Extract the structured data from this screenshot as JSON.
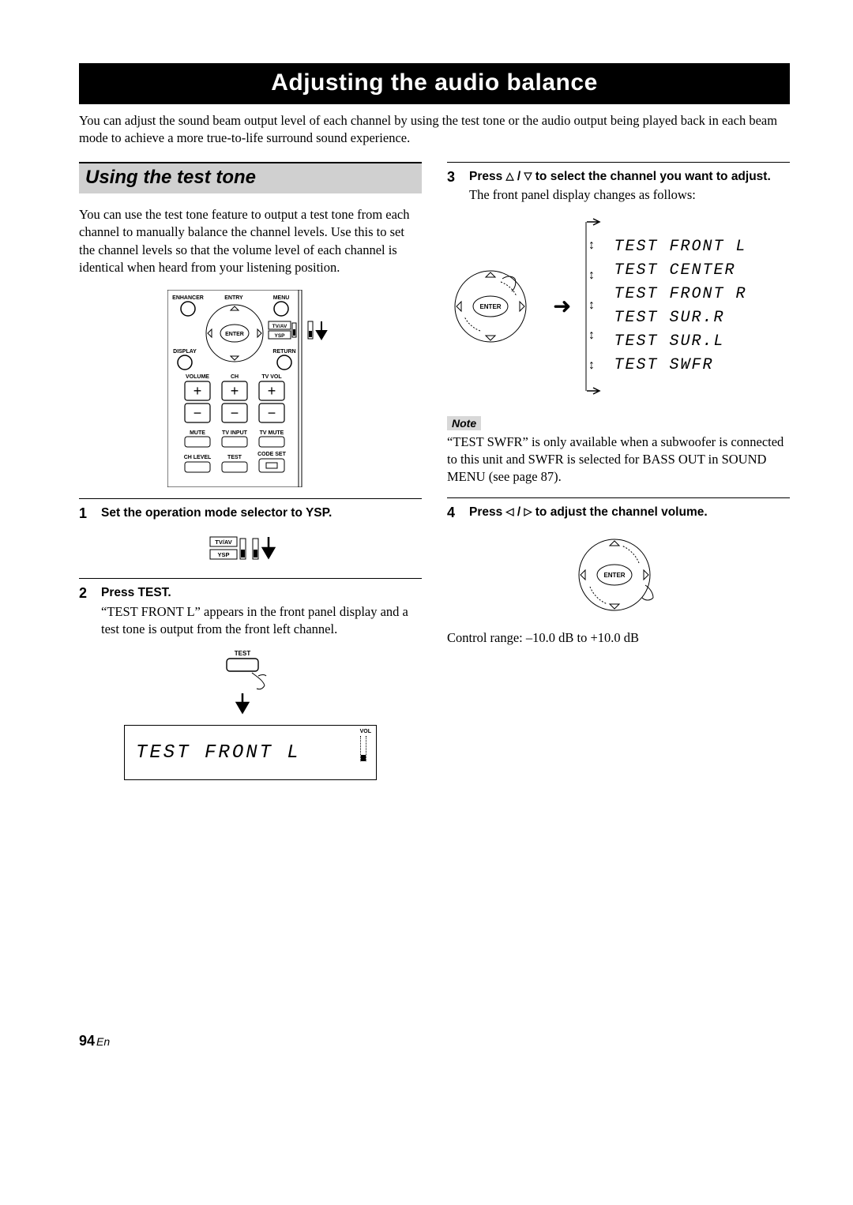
{
  "banner": "Adjusting the audio balance",
  "intro": "You can adjust the sound beam output level of each channel by using the test tone or the audio output being played back in each beam mode to achieve a more true-to-life surround sound experience.",
  "left": {
    "section_head": "Using the test tone",
    "section_body": "You can use the test tone feature to output a test tone from each channel to manually balance the channel levels. Use this to set the channel levels so that the volume level of each channel is identical when heard from your listening position.",
    "remote": {
      "row1": [
        "ENHANCER",
        "ENTRY",
        "MENU"
      ],
      "dpad_enter": "ENTER",
      "mode_labels": [
        "TV/AV",
        "YSP"
      ],
      "row2_left": "DISPLAY",
      "row2_right": "RETURN",
      "col_labels": [
        "VOLUME",
        "CH",
        "TV VOL"
      ],
      "plus": "+",
      "minus": "−",
      "row3": [
        "MUTE",
        "TV INPUT",
        "TV MUTE"
      ],
      "row4_left": "CH LEVEL",
      "row4_mid": "TEST",
      "row4_right": "CODE SET"
    },
    "step1_title": "Set the operation mode selector to YSP.",
    "step1_labels": [
      "TV/AV",
      "YSP"
    ],
    "step2_title": "Press TEST.",
    "step2_text": "“TEST FRONT L” appears in the front panel display and a test tone is output from the front left channel.",
    "step2_btn_label": "TEST",
    "panel_text": "TEST FRONT L",
    "panel_vol_label": "VOL"
  },
  "right": {
    "step3_title_a": "Press ",
    "step3_title_b": " / ",
    "step3_title_c": " to select the channel you want to adjust.",
    "step3_text": "The front panel display changes as follows:",
    "dpad_enter": "ENTER",
    "channels": [
      "TEST FRONT L",
      "TEST CENTER",
      "TEST FRONT R",
      "TEST SUR.R",
      "TEST SUR.L",
      "TEST SWFR"
    ],
    "note_label": "Note",
    "note_text": "“TEST SWFR” is only available when a subwoofer is connected to this unit and SWFR is selected for BASS OUT in SOUND MENU (see page 87).",
    "step4_title_a": "Press ",
    "step4_title_b": " / ",
    "step4_title_c": " to adjust the channel volume.",
    "range": "Control range: –10.0 dB to +10.0 dB"
  },
  "footer_num": "94",
  "footer_lang": "En"
}
